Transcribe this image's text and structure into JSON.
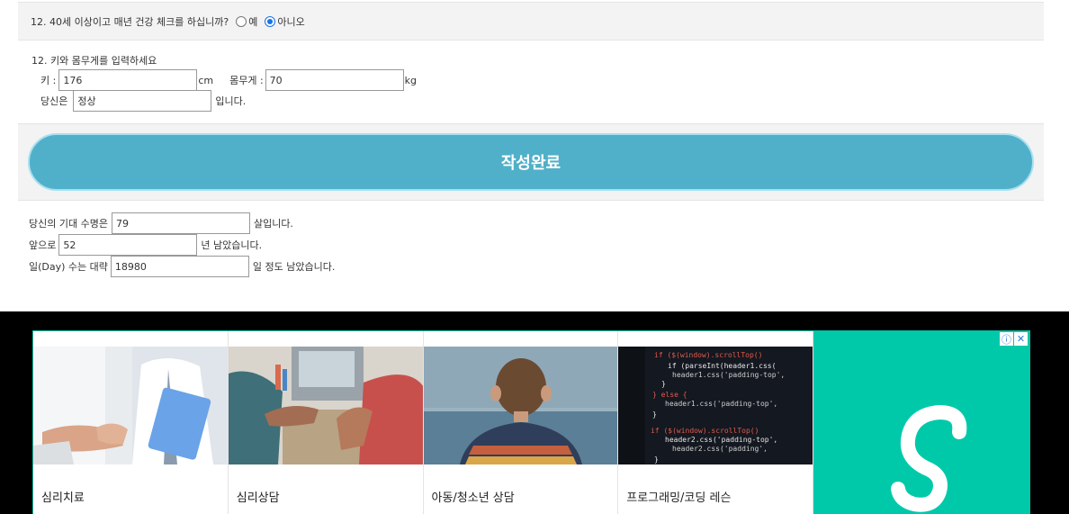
{
  "q12_checkup": {
    "question": "12. 40세 이상이고 매년 건강 체크를 하십니까?",
    "option_yes": "예",
    "option_no": "아니오",
    "selected": "아니오"
  },
  "bmi": {
    "title": "12. 키와 몸무게를 입력하세요",
    "height_label": "키 :",
    "height_value": "176",
    "height_unit": "cm",
    "weight_label": "몸무게 :",
    "weight_value": "70",
    "weight_unit": "kg",
    "status_prefix": "당신은",
    "status_value": "정상",
    "status_suffix": "입니다."
  },
  "submit": {
    "label": "작성완료"
  },
  "result": {
    "life_label": "당신의 기대 수명은",
    "life_value": "79",
    "life_suffix": "살입니다.",
    "remain_label": "앞으로",
    "remain_value": "52",
    "remain_suffix": "년 남았습니다.",
    "days_label": "일(Day) 수는 대략",
    "days_value": "18980",
    "days_suffix": "일 정도 남았습니다."
  },
  "ad": {
    "tiles": [
      {
        "label": "심리치료"
      },
      {
        "label": "심리상담"
      },
      {
        "label": "아동/청소년 상담"
      },
      {
        "label": "프로그래밍/코딩 레슨"
      }
    ],
    "brand_color": "#00c9aa"
  }
}
